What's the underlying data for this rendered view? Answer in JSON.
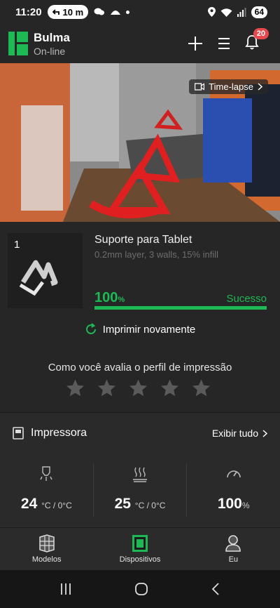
{
  "status_bar": {
    "time": "11:20",
    "call_duration": "10 m",
    "battery": "64"
  },
  "header": {
    "printer_name": "Bulma",
    "connection": "On-line",
    "notification_count": "20",
    "icons": [
      "add-icon",
      "menu-icon",
      "bell-icon"
    ]
  },
  "camera": {
    "timelapse_label": "Time-lapse"
  },
  "job": {
    "plate_number": "1",
    "name": "Suporte para Tablet",
    "params": "0.2mm layer, 3 walls, 15% infill",
    "progress_value": "100",
    "progress_unit": "%",
    "progress_fraction": 1.0,
    "status": "Sucesso",
    "reprint_label": "Imprimir novamente",
    "rating_question": "Como você avalia o perfil de impressão",
    "stars_total": 5,
    "stars_selected": 0
  },
  "printer_panel": {
    "title": "Impressora",
    "see_all": "Exibir tudo",
    "stats": [
      {
        "icon": "nozzle-icon",
        "value": "24",
        "unit": "°C / 0°C"
      },
      {
        "icon": "heatbed-icon",
        "value": "25",
        "unit": "°C / 0°C"
      },
      {
        "icon": "speed-gauge-icon",
        "value": "100",
        "unit": "%"
      }
    ]
  },
  "bottom_nav": [
    {
      "label": "Modelos",
      "icon": "models-icon"
    },
    {
      "label": "Dispositivos",
      "icon": "devices-icon",
      "active": true
    },
    {
      "label": "Eu",
      "icon": "profile-icon"
    }
  ],
  "colors": {
    "accent": "#1db954",
    "background": "#262626",
    "badge": "#e5484d"
  }
}
